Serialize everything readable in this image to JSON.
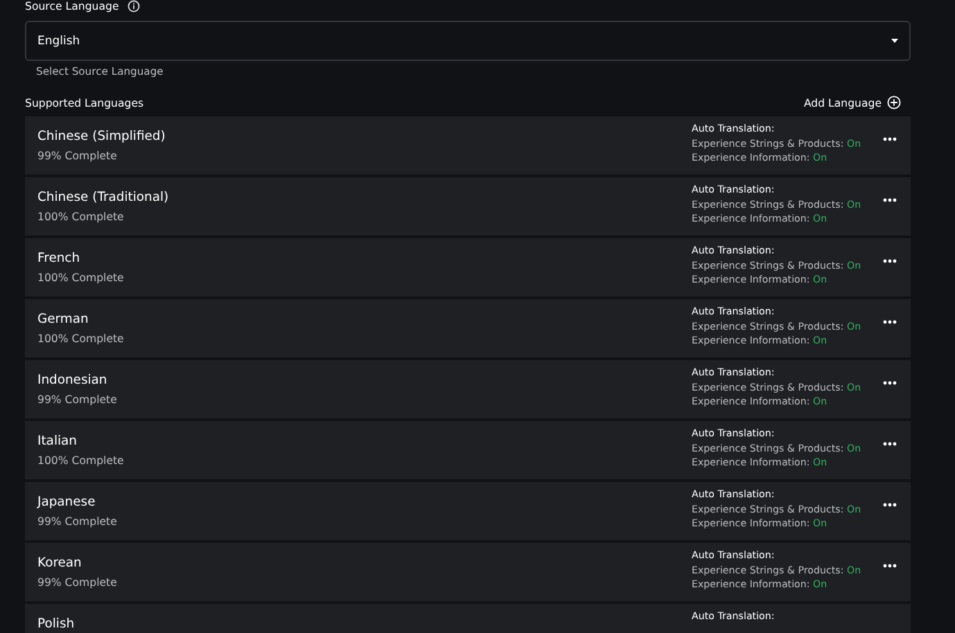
{
  "source_language": {
    "label": "Source Language",
    "value": "English",
    "helper": "Select Source Language"
  },
  "supported": {
    "title": "Supported Languages",
    "add_label": "Add Language"
  },
  "languages": [
    {
      "name": "Chinese (Simplified)",
      "progress": "99% Complete",
      "auto_label": "Auto Translation:",
      "strings_label": "Experience Strings & Products:",
      "strings_value": "On",
      "info_label": "Experience Information:",
      "info_value": "On"
    },
    {
      "name": "Chinese (Traditional)",
      "progress": "100% Complete",
      "auto_label": "Auto Translation:",
      "strings_label": "Experience Strings & Products:",
      "strings_value": "On",
      "info_label": "Experience Information:",
      "info_value": "On"
    },
    {
      "name": "French",
      "progress": "100% Complete",
      "auto_label": "Auto Translation:",
      "strings_label": "Experience Strings & Products:",
      "strings_value": "On",
      "info_label": "Experience Information:",
      "info_value": "On"
    },
    {
      "name": "German",
      "progress": "100% Complete",
      "auto_label": "Auto Translation:",
      "strings_label": "Experience Strings & Products:",
      "strings_value": "On",
      "info_label": "Experience Information:",
      "info_value": "On"
    },
    {
      "name": "Indonesian",
      "progress": "99% Complete",
      "auto_label": "Auto Translation:",
      "strings_label": "Experience Strings & Products:",
      "strings_value": "On",
      "info_label": "Experience Information:",
      "info_value": "On"
    },
    {
      "name": "Italian",
      "progress": "100% Complete",
      "auto_label": "Auto Translation:",
      "strings_label": "Experience Strings & Products:",
      "strings_value": "On",
      "info_label": "Experience Information:",
      "info_value": "On"
    },
    {
      "name": "Japanese",
      "progress": "99% Complete",
      "auto_label": "Auto Translation:",
      "strings_label": "Experience Strings & Products:",
      "strings_value": "On",
      "info_label": "Experience Information:",
      "info_value": "On"
    },
    {
      "name": "Korean",
      "progress": "99% Complete",
      "auto_label": "Auto Translation:",
      "strings_label": "Experience Strings & Products:",
      "strings_value": "On",
      "info_label": "Experience Information:",
      "info_value": "On"
    },
    {
      "name": "Polish",
      "auto_label": "Auto Translation:"
    }
  ]
}
